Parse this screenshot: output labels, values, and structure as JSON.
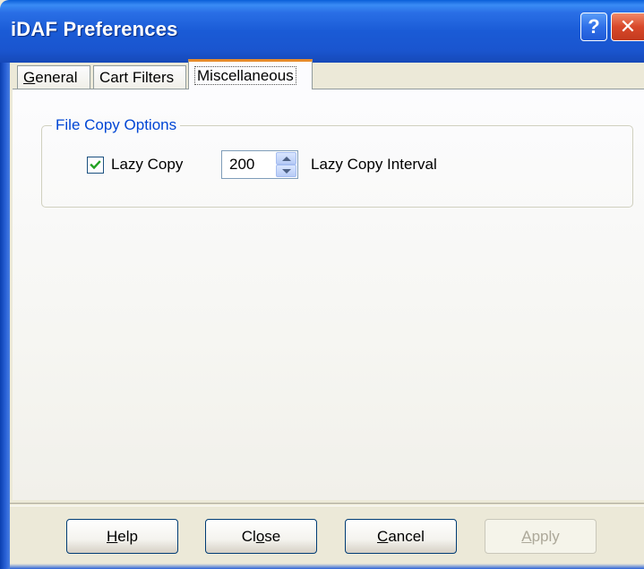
{
  "window": {
    "title": "iDAF Preferences",
    "help_glyph": "?",
    "close_glyph": "✕"
  },
  "tabs": [
    {
      "label_mnemonic": "G",
      "label_rest": "eneral",
      "selected": false
    },
    {
      "label": "Cart Filters",
      "selected": false
    },
    {
      "label": "Miscellaneous",
      "selected": true
    }
  ],
  "group": {
    "legend": "File Copy Options",
    "lazy_copy": {
      "label": "Lazy Copy",
      "checked": true
    },
    "interval": {
      "value": "200",
      "label": "Lazy Copy Interval"
    }
  },
  "buttons": {
    "help": {
      "mnemonic": "H",
      "rest": "elp"
    },
    "close": {
      "before": "Cl",
      "mnemonic": "o",
      "rest": "se"
    },
    "cancel": {
      "mnemonic": "C",
      "rest": "ancel"
    },
    "apply": {
      "mnemonic": "A",
      "rest": "pply",
      "enabled": false
    }
  },
  "colors": {
    "title_bar": "#1a5bd6",
    "group_legend": "#0046d5",
    "selected_tab_accent": "#e68b2c",
    "close_button": "#d8482a"
  }
}
